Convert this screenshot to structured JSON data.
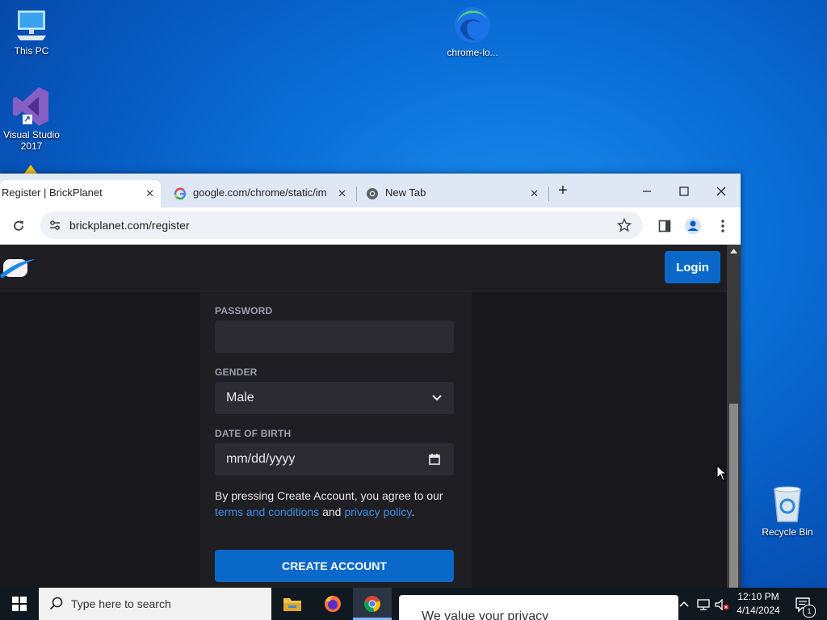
{
  "desktop": {
    "icons": [
      {
        "label": "This PC"
      },
      {
        "label": "chrome-lo..."
      },
      {
        "label": "Visual Studio 2017"
      },
      {
        "label": "Recycle Bin"
      }
    ]
  },
  "browser": {
    "tabs": [
      {
        "title": "Register | BrickPlanet",
        "active": true
      },
      {
        "title": "google.com/chrome/static/im",
        "active": false
      },
      {
        "title": "New Tab",
        "active": false
      }
    ],
    "new_tab_label": "+",
    "address": "brickplanet.com/register"
  },
  "page": {
    "login_label": "Login",
    "form": {
      "password_label": "PASSWORD",
      "password_value": "",
      "gender_label": "GENDER",
      "gender_value": "Male",
      "dob_label": "DATE OF BIRTH",
      "dob_placeholder": "mm/dd/yyyy",
      "terms_prefix": "By pressing Create Account, you agree to our ",
      "terms_link": "terms and conditions",
      "terms_mid": " and ",
      "privacy_link": "privacy policy",
      "terms_suffix": ".",
      "create_label": "CREATE ACCOUNT"
    }
  },
  "taskbar": {
    "search_placeholder": "Type here to search",
    "privacy_popup_text": "We value your privacy",
    "time": "12:10 PM",
    "date": "4/14/2024",
    "notification_count": "1"
  },
  "colors": {
    "accent": "#0a69c8",
    "link": "#3f8ee8",
    "page_bg": "#17171c"
  }
}
